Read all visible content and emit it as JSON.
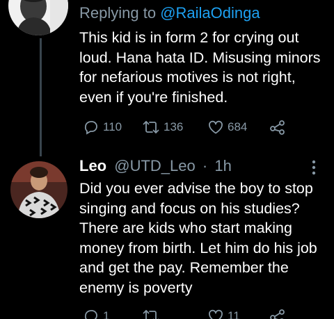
{
  "tweet1": {
    "replying_prefix": "Replying to",
    "replying_to": "@RailaOdinga",
    "text": "This kid is in form 2 for crying out\nloud. Hana hata ID. Misusing minors\nfor nefarious motives is not right,\neven if you're finished.",
    "replies": "110",
    "retweets": "136",
    "likes": "684"
  },
  "tweet2": {
    "name": "Leo",
    "handle": "@UTD_Leo",
    "separator": "·",
    "time": "1h",
    "text": "Did you ever advise the boy to stop\nsinging and focus on his studies?\nThere are kids who start making\nmoney from birth. Let him do his job\nand get the pay. Remember the\nenemy is poverty",
    "replies": "1",
    "retweets": "",
    "likes": "11"
  },
  "icons": {
    "reply": "speech-bubble-icon",
    "retweet": "retweet-arrows-icon",
    "like": "heart-outline-icon",
    "share": "share-nodes-icon",
    "more": "vertical-dots-icon"
  },
  "colors": {
    "background": "#000000",
    "text": "#ffffff",
    "muted": "#8899a6",
    "link": "#1da1f2",
    "thread_line": "#38444d"
  }
}
